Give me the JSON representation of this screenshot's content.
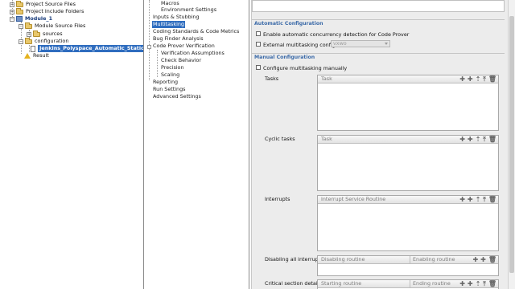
{
  "tree": {
    "items": [
      {
        "label": "Project Source Files"
      },
      {
        "label": "Project Include Folders"
      },
      {
        "label": "Module_1"
      },
      {
        "label": "Module Source Files"
      },
      {
        "label": "sources"
      },
      {
        "label": "configuration"
      },
      {
        "label": "Jenkins_Polyspace_Automatic_Static_Testi"
      },
      {
        "label": "Result"
      }
    ]
  },
  "nav": {
    "items": [
      {
        "label": "Macros"
      },
      {
        "label": "Environment Settings"
      },
      {
        "label": "Inputs & Stubbing"
      },
      {
        "label": "Multitasking"
      },
      {
        "label": "Coding Standards & Code Metrics"
      },
      {
        "label": "Bug Finder Analysis"
      },
      {
        "label": "Code Prover Verification"
      },
      {
        "label": "Verification Assumptions"
      },
      {
        "label": "Check Behavior"
      },
      {
        "label": "Precision"
      },
      {
        "label": "Scaling"
      },
      {
        "label": "Reporting"
      },
      {
        "label": "Run Settings"
      },
      {
        "label": "Advanced Settings"
      }
    ],
    "selected": "Multitasking"
  },
  "config": {
    "auto_section": "Automatic Configuration",
    "enable_auto_label": "Enable automatic concurrency detection for Code Prover",
    "external_label": "External multitasking configuration",
    "external_value": "vxwo",
    "manual_section": "Manual Configuration",
    "configure_manual_label": "Configure multitasking manually",
    "tasks": {
      "label": "Tasks",
      "header": "Task"
    },
    "cyclic": {
      "label": "Cyclic tasks",
      "header": "Task"
    },
    "interrupts": {
      "label": "Interrupts",
      "header": "Interrupt Service Routine"
    },
    "disabling": {
      "label": "Disabling all interrupts",
      "header_a": "Disabling routine",
      "header_b": "Enabling routine"
    },
    "critical": {
      "label": "Critical section details",
      "header_a": "Starting routine",
      "header_b": "Ending routine"
    }
  },
  "toolbar_icons": [
    "add-icon",
    "add-many-icon",
    "move-up-icon",
    "move-top-icon",
    "delete-icon"
  ]
}
